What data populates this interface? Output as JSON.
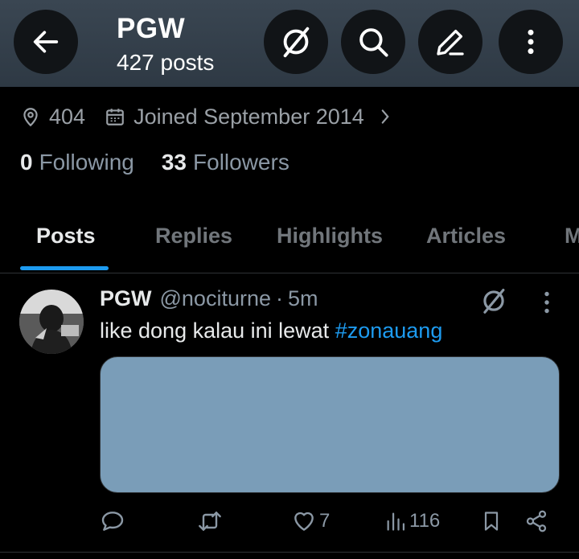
{
  "header": {
    "title": "PGW",
    "subtitle": "427 posts"
  },
  "profile": {
    "location": "404",
    "joined": "Joined September 2014",
    "following_count": "0",
    "following_label": "Following",
    "followers_count": "33",
    "followers_label": "Followers"
  },
  "tabs": [
    {
      "label": "Posts",
      "active": true
    },
    {
      "label": "Replies"
    },
    {
      "label": "Highlights"
    },
    {
      "label": "Articles"
    },
    {
      "label": "M"
    }
  ],
  "post": {
    "name": "PGW",
    "handle": "@nociturne",
    "separator": "·",
    "time": "5m",
    "text": "like dong kalau ini lewat",
    "hashtag": "#zonauang",
    "media_color": "#7a9db8",
    "actions": {
      "reply_icon": "reply-icon",
      "repost_icon": "repost-icon",
      "likes": "7",
      "views": "116",
      "bookmark_icon": "bookmark-icon",
      "share_icon": "share-icon"
    }
  },
  "colors": {
    "accent": "#1d9bf0",
    "header_bg": "#36414c",
    "background": "#000000",
    "muted_text": "#8b98a5"
  }
}
